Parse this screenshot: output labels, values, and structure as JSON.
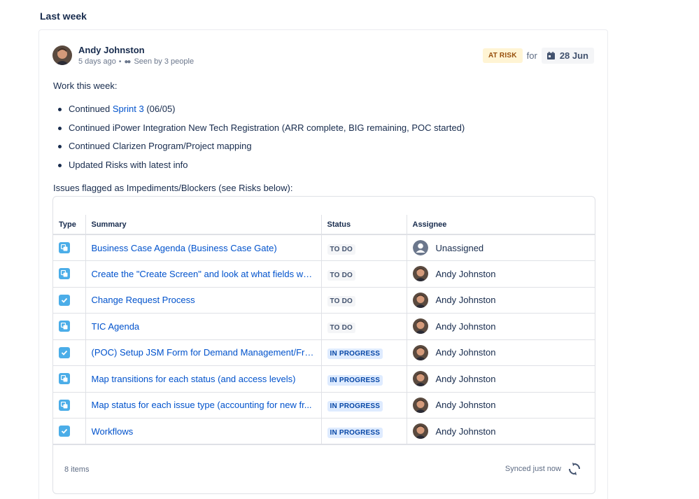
{
  "section": {
    "title": "Last week"
  },
  "update": {
    "author": "Andy Johnston",
    "time": "5 days ago",
    "seen": "Seen by 3 people",
    "status": "AT RISK",
    "for_label": "for",
    "date": "28 Jun",
    "intro": "Work this week:",
    "bullets": [
      {
        "prefix": "Continued ",
        "link": "Sprint 3",
        "suffix": " (06/05)"
      },
      {
        "text": "Continued iPower Integration New Tech Registration (ARR complete, BIG remaining, POC started)"
      },
      {
        "text": "Continued Clarizen Program/Project mapping"
      },
      {
        "text": "Updated Risks with latest info"
      }
    ],
    "issues_label": "Issues flagged as Impediments/Blockers (see Risks below):"
  },
  "table": {
    "headers": {
      "type": "Type",
      "summary": "Summary",
      "status": "Status",
      "assignee": "Assignee"
    },
    "rows": [
      {
        "type_icon": "subtask-icon",
        "summary": "Business Case Agenda (Business Case Gate)",
        "status": "TO DO",
        "assignee": "Unassigned"
      },
      {
        "type_icon": "subtask-icon",
        "summary": "Create the \"Create Screen\" and look at what fields wo...",
        "status": "TO DO",
        "assignee": "Andy Johnston"
      },
      {
        "type_icon": "task-icon",
        "summary": "Change Request Process",
        "status": "TO DO",
        "assignee": "Andy Johnston"
      },
      {
        "type_icon": "subtask-icon",
        "summary": "TIC Agenda",
        "status": "TO DO",
        "assignee": "Andy Johnston"
      },
      {
        "type_icon": "task-icon",
        "summary": "(POC) Setup JSM Form for Demand Management/Fro...",
        "status": "IN PROGRESS",
        "assignee": "Andy Johnston"
      },
      {
        "type_icon": "subtask-icon",
        "summary": "Map transitions for each status (and access levels)",
        "status": "IN PROGRESS",
        "assignee": "Andy Johnston"
      },
      {
        "type_icon": "subtask-icon",
        "summary": "Map status for each issue type (accounting for new fr...",
        "status": "IN PROGRESS",
        "assignee": "Andy Johnston"
      },
      {
        "type_icon": "task-icon",
        "summary": "Workflows",
        "status": "IN PROGRESS",
        "assignee": "Andy Johnston"
      }
    ],
    "footer": {
      "count": "8 items",
      "sync": "Synced just now"
    }
  },
  "colors": {
    "link": "#0052cc",
    "at_risk_bg": "#fff4d4",
    "in_progress_bg": "#deebff",
    "type_icon": "#4bade8"
  }
}
